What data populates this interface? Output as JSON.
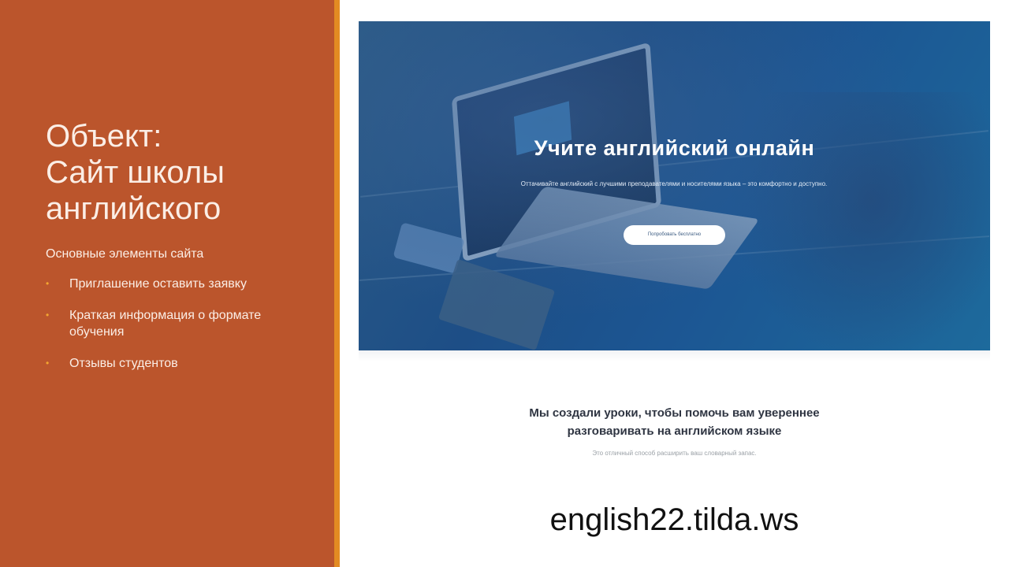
{
  "slide": {
    "title_lines": [
      "Объект:",
      "Сайт школы",
      "английского"
    ],
    "subtitle": "Основные элементы сайта",
    "bullets": [
      "Приглашение оставить заявку",
      "Краткая информация о формате обучения",
      "Отзывы студентов"
    ],
    "bullet_glyph": "•",
    "colors": {
      "panel": "#bb552c",
      "accent": "#e38b22",
      "bullet": "#f3a531"
    }
  },
  "website": {
    "hero_title": "Учите английский онлайн",
    "hero_subtitle": "Оттачивайте английский с лучшими преподавателями и носителями языка – это комфортно и доступно.",
    "hero_button": "Попробовать бесплатно",
    "lead_lines": [
      "Мы создали уроки, чтобы помочь вам увереннее",
      "разговаривать на английском языке"
    ],
    "small_note": "Это отличный способ расширить ваш словарный запас."
  },
  "url": "english22.tilda.ws"
}
